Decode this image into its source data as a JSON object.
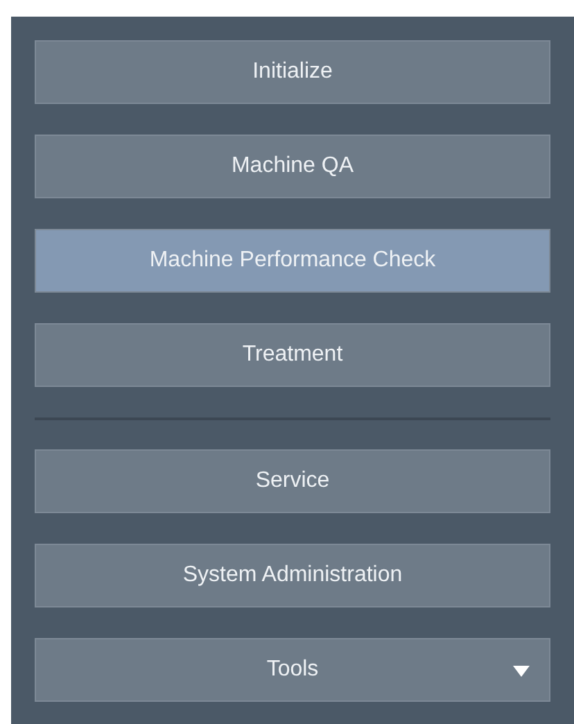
{
  "menu_groups": [
    {
      "items": [
        {
          "label": "Initialize",
          "selected": false,
          "kind": "button"
        },
        {
          "label": "Machine QA",
          "selected": false,
          "kind": "button"
        },
        {
          "label": "Machine Performance Check",
          "selected": true,
          "kind": "button"
        },
        {
          "label": "Treatment",
          "selected": false,
          "kind": "button"
        }
      ]
    },
    {
      "items": [
        {
          "label": "Service",
          "selected": false,
          "kind": "button"
        },
        {
          "label": "System Administration",
          "selected": false,
          "kind": "button"
        },
        {
          "label": "Tools",
          "selected": false,
          "kind": "dropdown"
        }
      ]
    }
  ]
}
